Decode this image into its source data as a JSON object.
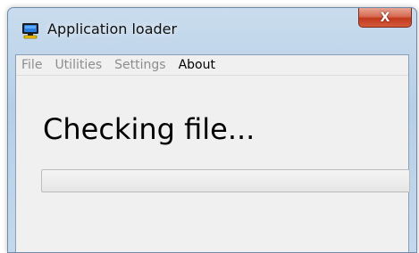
{
  "window": {
    "title": "Application loader",
    "close_label": "X"
  },
  "menu": [
    {
      "label": "File",
      "enabled": false
    },
    {
      "label": "Utilities",
      "enabled": false
    },
    {
      "label": "Settings",
      "enabled": false
    },
    {
      "label": "About",
      "enabled": true
    }
  ],
  "status": {
    "message": "Checking file..."
  },
  "progress": {
    "value_percent": 0
  },
  "colors": {
    "disabled_menu": "#8d8d8d",
    "enabled_menu": "#000000",
    "close_button": "#c2391d"
  },
  "icons": {
    "app": "monitor-icon",
    "close": "close-icon"
  }
}
